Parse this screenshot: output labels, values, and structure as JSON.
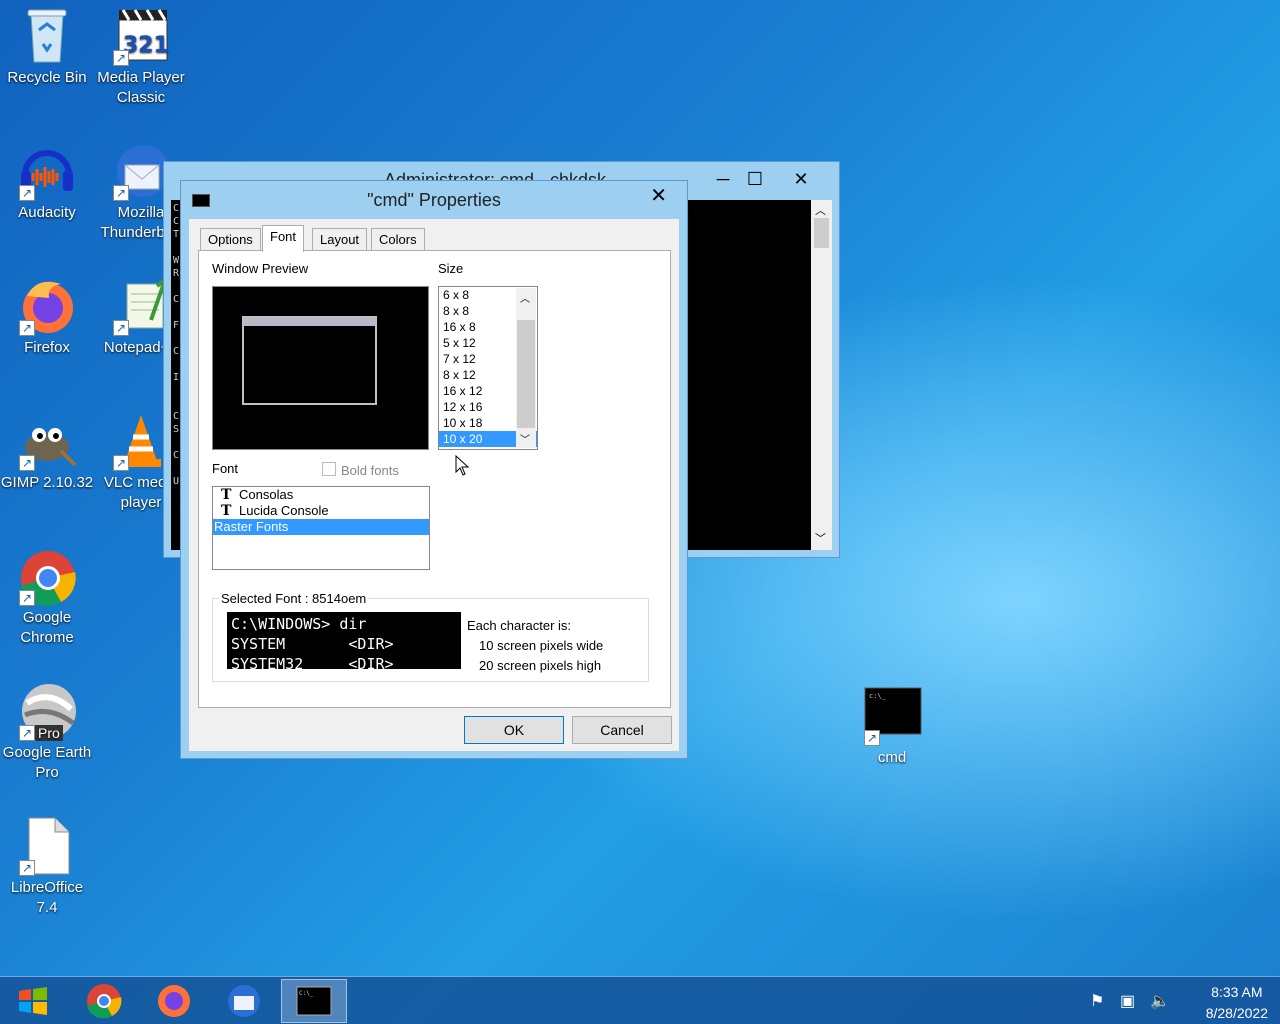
{
  "desktop": {
    "icons": [
      {
        "label": "Recycle Bin"
      },
      {
        "label": "Media Player Classic"
      },
      {
        "label": "Audacity"
      },
      {
        "label": "Mozilla Thunderbird"
      },
      {
        "label": "Firefox"
      },
      {
        "label": "Notepad++"
      },
      {
        "label": "GIMP 2.10.32"
      },
      {
        "label": "VLC media player"
      },
      {
        "label": "Google Chrome"
      },
      {
        "label": "Google Earth Pro"
      },
      {
        "label": "LibreOffice 7.4"
      },
      {
        "label": "cmd"
      }
    ],
    "earth_badge": "Pro"
  },
  "back_window": {
    "title": "Administrator: cmd - chkdsk",
    "left_chars": [
      "C",
      "C",
      "T",
      "",
      "W",
      "R",
      "",
      "C",
      "",
      "F",
      "",
      "C",
      "",
      "I",
      "",
      "",
      "C",
      "S",
      "",
      "C",
      "",
      "U"
    ]
  },
  "dialog": {
    "title": "\"cmd\" Properties",
    "close": "✕",
    "tabs": [
      {
        "label": "Options"
      },
      {
        "label": "Font"
      },
      {
        "label": "Layout"
      },
      {
        "label": "Colors"
      }
    ],
    "window_preview_label": "Window Preview",
    "size_label": "Size",
    "sizes": [
      "6 x  8",
      "8 x  8",
      "16 x  8",
      "5 x 12",
      "7 x 12",
      "8 x 12",
      "16 x 12",
      "12 x 16",
      "10 x 18",
      "10 x 20"
    ],
    "font_label": "Font",
    "bold_fonts_label": "Bold fonts",
    "fonts": [
      "Consolas",
      "Lucida Console",
      "Raster Fonts"
    ],
    "selected_font_label": "Selected Font : 8514oem",
    "sample_lines": [
      "C:\\WINDOWS> dir",
      "SYSTEM       <DIR>",
      "SYSTEM32     <DIR>"
    ],
    "each_char_label": "Each character is:",
    "pixels_wide": "10 screen pixels wide",
    "pixels_high": "20 screen pixels high",
    "ok": "OK",
    "cancel": "Cancel"
  },
  "taskbar": {
    "time": "8:33 AM",
    "date": "8/28/2022"
  }
}
